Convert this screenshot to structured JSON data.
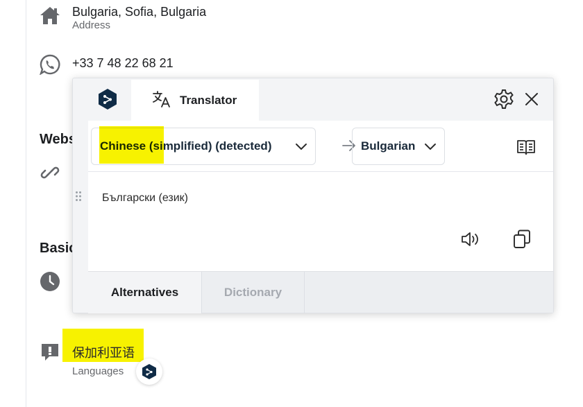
{
  "profile": {
    "address": {
      "value": "Bulgaria, Sofia, Bulgaria",
      "label": "Address",
      "icon": "home-icon"
    },
    "phone": {
      "value": "+33 7 48 22 68 21",
      "icon": "whatsapp-icon"
    },
    "website_section": {
      "title": "Webs",
      "icon": "link-icon"
    },
    "basic_section": {
      "title": "Basic",
      "icon": "clock-icon"
    },
    "languages": {
      "value": "保加利亚语",
      "label": "Languages",
      "icon": "speech-bubble-icon"
    }
  },
  "translator": {
    "logo": "deepl-logo-icon",
    "tab_label": "Translator",
    "source_language": "Chinese (simplified) (detected)",
    "target_language": "Bulgarian",
    "source_text": "Български (език)",
    "footer_tabs": [
      "Alternatives",
      "Dictionary"
    ]
  },
  "colors": {
    "highlight": "#f7f200",
    "brand_dark": "#0f2b46"
  }
}
